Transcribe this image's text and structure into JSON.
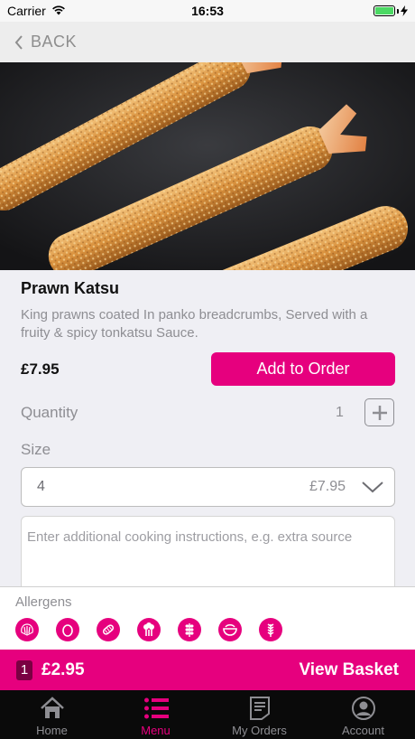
{
  "status_bar": {
    "carrier": "Carrier",
    "time": "16:53"
  },
  "nav": {
    "back_label": "BACK"
  },
  "item": {
    "title": "Prawn Katsu",
    "description": "King prawns coated In panko breadcrumbs, Served with a fruity & spicy tonkatsu Sauce.",
    "price": "£7.95",
    "add_button_label": "Add to Order"
  },
  "quantity": {
    "label": "Quantity",
    "value": "1"
  },
  "size": {
    "label": "Size",
    "selected_value": "4",
    "selected_price": "£7.95"
  },
  "instructions": {
    "placeholder": "Enter additional cooking instructions, e.g. extra source",
    "value": ""
  },
  "allergens": {
    "label": "Allergens",
    "icons": [
      "shellfish-icon",
      "egg-icon",
      "gluten-bread-icon",
      "celery-icon",
      "cereal-grain-icon",
      "bowl-soup-icon",
      "wheat-icon"
    ]
  },
  "basket": {
    "count": "1",
    "total": "£2.95",
    "view_label": "View Basket"
  },
  "tabs": [
    {
      "label": "Home",
      "icon": "home-icon",
      "active": false
    },
    {
      "label": "Menu",
      "icon": "menu-list-icon",
      "active": true
    },
    {
      "label": "My Orders",
      "icon": "orders-document-icon",
      "active": false
    },
    {
      "label": "Account",
      "icon": "account-user-icon",
      "active": false
    }
  ],
  "colors": {
    "accent": "#e6007e",
    "tab_bar": "#0a0a0a",
    "background": "#efeff4"
  }
}
